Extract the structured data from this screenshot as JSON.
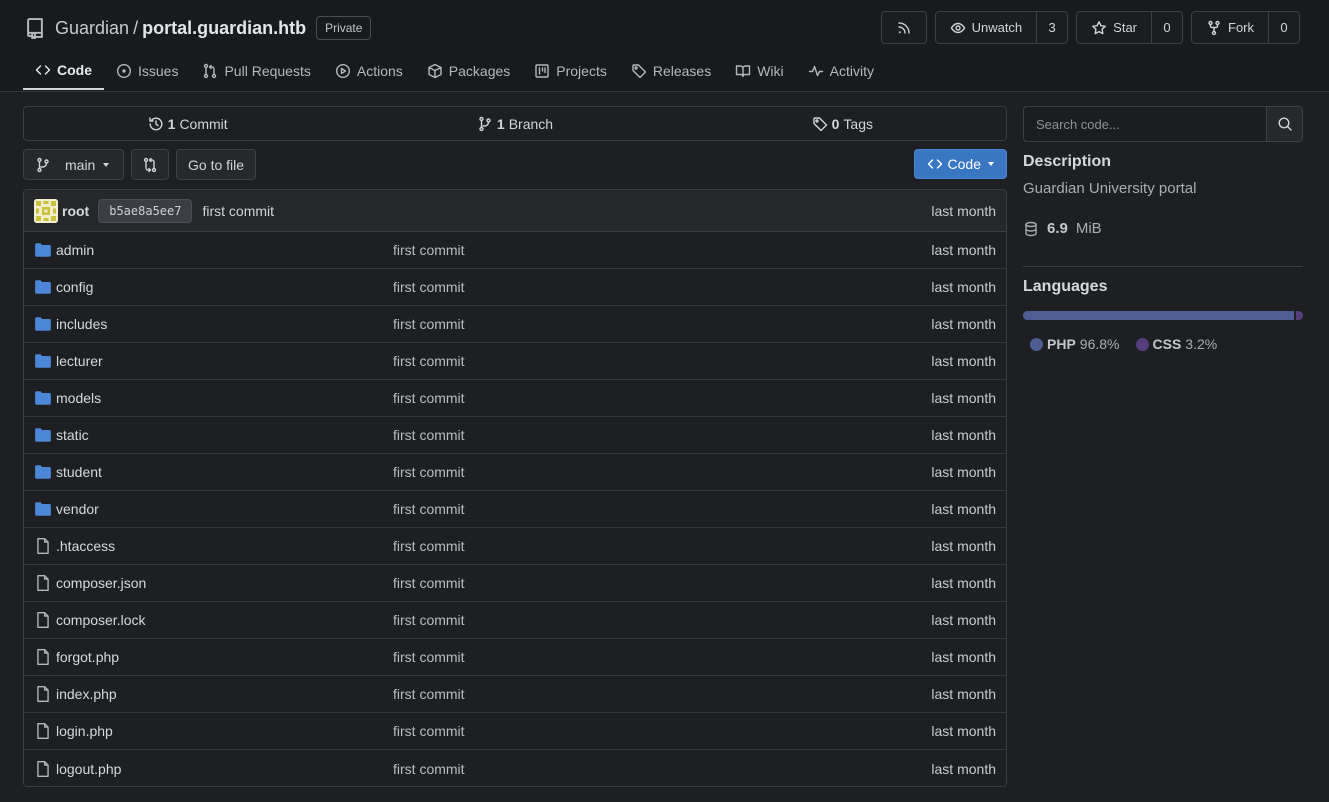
{
  "repo": {
    "owner": "Guardian",
    "separator": "/",
    "name": "portal.guardian.htb",
    "visibility": "Private"
  },
  "header_actions": {
    "unwatch_label": "Unwatch",
    "watch_count": "3",
    "star_label": "Star",
    "star_count": "0",
    "fork_label": "Fork",
    "fork_count": "0"
  },
  "tabs": [
    {
      "label": "Code",
      "icon": "code-icon",
      "active": true
    },
    {
      "label": "Issues",
      "icon": "issue-icon"
    },
    {
      "label": "Pull Requests",
      "icon": "pull-request-icon"
    },
    {
      "label": "Actions",
      "icon": "play-icon"
    },
    {
      "label": "Packages",
      "icon": "package-icon"
    },
    {
      "label": "Projects",
      "icon": "project-icon"
    },
    {
      "label": "Releases",
      "icon": "tag-icon"
    },
    {
      "label": "Wiki",
      "icon": "book-icon"
    },
    {
      "label": "Activity",
      "icon": "pulse-icon"
    }
  ],
  "summary": {
    "commits_count": "1",
    "commits_label": "Commit",
    "branches_count": "1",
    "branches_label": "Branch",
    "tags_count": "0",
    "tags_label": "Tags"
  },
  "toolbar": {
    "branch": "main",
    "go_to_file": "Go to file",
    "code_button": "Code"
  },
  "latest_commit": {
    "author": "root",
    "sha": "b5ae8a5ee7",
    "message": "first commit",
    "when": "last month"
  },
  "files": [
    {
      "name": "admin",
      "type": "dir",
      "message": "first commit",
      "when": "last month"
    },
    {
      "name": "config",
      "type": "dir",
      "message": "first commit",
      "when": "last month"
    },
    {
      "name": "includes",
      "type": "dir",
      "message": "first commit",
      "when": "last month"
    },
    {
      "name": "lecturer",
      "type": "dir",
      "message": "first commit",
      "when": "last month"
    },
    {
      "name": "models",
      "type": "dir",
      "message": "first commit",
      "when": "last month"
    },
    {
      "name": "static",
      "type": "dir",
      "message": "first commit",
      "when": "last month"
    },
    {
      "name": "student",
      "type": "dir",
      "message": "first commit",
      "when": "last month"
    },
    {
      "name": "vendor",
      "type": "dir",
      "message": "first commit",
      "when": "last month"
    },
    {
      "name": ".htaccess",
      "type": "file",
      "message": "first commit",
      "when": "last month"
    },
    {
      "name": "composer.json",
      "type": "file",
      "message": "first commit",
      "when": "last month"
    },
    {
      "name": "composer.lock",
      "type": "file",
      "message": "first commit",
      "when": "last month"
    },
    {
      "name": "forgot.php",
      "type": "file",
      "message": "first commit",
      "when": "last month"
    },
    {
      "name": "index.php",
      "type": "file",
      "message": "first commit",
      "when": "last month"
    },
    {
      "name": "login.php",
      "type": "file",
      "message": "first commit",
      "when": "last month"
    },
    {
      "name": "logout.php",
      "type": "file",
      "message": "first commit",
      "when": "last month"
    }
  ],
  "sidebar": {
    "search_placeholder": "Search code...",
    "description_heading": "Description",
    "description": "Guardian University portal",
    "size_value": "6.9",
    "size_unit": "MiB",
    "languages_heading": "Languages",
    "languages": [
      {
        "name": "PHP",
        "percent": "96.8%",
        "fraction": 0.968,
        "color": "#4f5d95"
      },
      {
        "name": "CSS",
        "percent": "3.2%",
        "fraction": 0.032,
        "color": "#563d7c"
      }
    ]
  },
  "colors": {
    "accent": "#3a77c3",
    "folder": "#4c86d6"
  }
}
